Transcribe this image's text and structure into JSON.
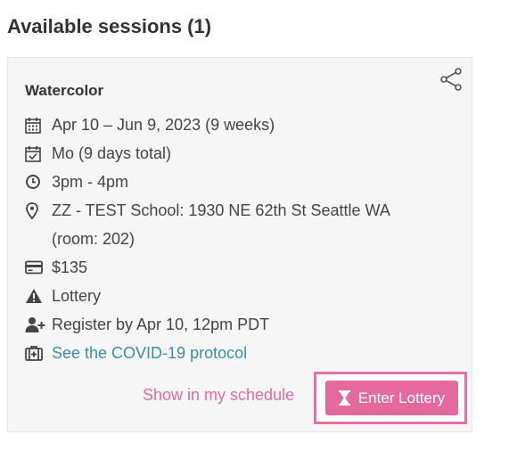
{
  "section_title": "Available sessions (1)",
  "session": {
    "title": "Watercolor",
    "share_icon": "share-icon",
    "dates": "Apr 10 – Jun 9, 2023 (9 weeks)",
    "days": "Mo (9 days total)",
    "time": "3pm - 4pm",
    "location_line1": "ZZ - TEST School: 1930 NE 62th St Seattle WA",
    "location_line2": "(room: 202)",
    "price": "$135",
    "enrollment_type": "Lottery",
    "register_by": "Register by Apr 10, 12pm PDT",
    "covid_link": "See the COVID-19 protocol"
  },
  "actions": {
    "show_schedule_label": "Show in my schedule",
    "enter_lottery_label": "Enter Lottery"
  },
  "colors": {
    "accent_pink": "#e46a9e",
    "link_teal": "#3a8f9c",
    "card_bg": "#f6f6f6"
  }
}
